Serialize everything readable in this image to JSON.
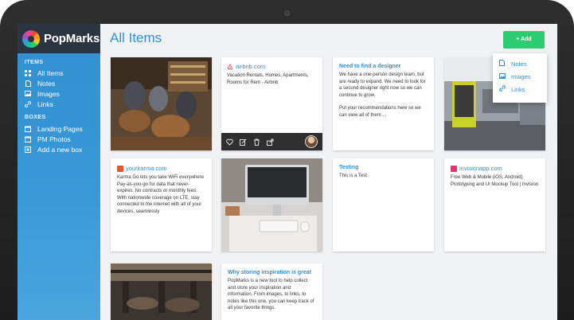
{
  "app": {
    "name": "PopMarks"
  },
  "header": {
    "title": "All Items",
    "add_label": "+ Add"
  },
  "sidebar": {
    "items_heading": "ITEMS",
    "items": [
      {
        "label": "All Items",
        "icon": "grid-icon"
      },
      {
        "label": "Notes",
        "icon": "note-icon"
      },
      {
        "label": "Images",
        "icon": "image-icon"
      },
      {
        "label": "Links",
        "icon": "link-icon"
      }
    ],
    "boxes_heading": "BOXES",
    "boxes": [
      {
        "label": "Landing Pages",
        "icon": "box-icon"
      },
      {
        "label": "PM Photos",
        "icon": "box-icon"
      },
      {
        "label": "Add a new box",
        "icon": "plus-box-icon"
      }
    ]
  },
  "add_menu": {
    "items": [
      {
        "label": "Notes",
        "icon": "note-icon"
      },
      {
        "label": "Images",
        "icon": "image-icon"
      },
      {
        "label": "Links",
        "icon": "link-icon"
      }
    ]
  },
  "cards": {
    "airbnb": {
      "source": "airbnb.com",
      "text": "Vacation Rentals, Homes, Apartments, Rooms for Rent - Airbnb"
    },
    "designer": {
      "title": "Need to find a designer",
      "text1": "We have a one-person design team, but are ready to expand. We need to look for a second designer right now so we can continue to grow.",
      "text2": "Put your recommendations here so we can view all of them ..."
    },
    "yourkarma": {
      "source": "yourkarma.com",
      "text": "Karma Go lets you take WiFi everywhere Pay-as-you-go for data that never-expires. No contracts or monthly fees. With nationwide coverage on LTE, stay connected to the internet with all of your devices, seamlessly"
    },
    "testing": {
      "title": "Testing",
      "text": "This is a Test"
    },
    "invision": {
      "source": "invisionapp.com",
      "text": "Free Web & Mobile (iOS, Android) Prototyping and UI Mockup Tool | Invision"
    },
    "inspiration": {
      "title": "Why storing inspiration is great",
      "text": "PopMarks is a new tool to help collect and store your inspiration and information. From images, to links, to notes like this one, you can keep track of all your favorite things."
    }
  },
  "colors": {
    "accent": "#2e8fd3",
    "add_button": "#2ecc71",
    "brand_bar": "#2b3542",
    "airbnb": "#ff5a5f",
    "yourkarma": "#e8542e",
    "invision": "#e8336d"
  }
}
